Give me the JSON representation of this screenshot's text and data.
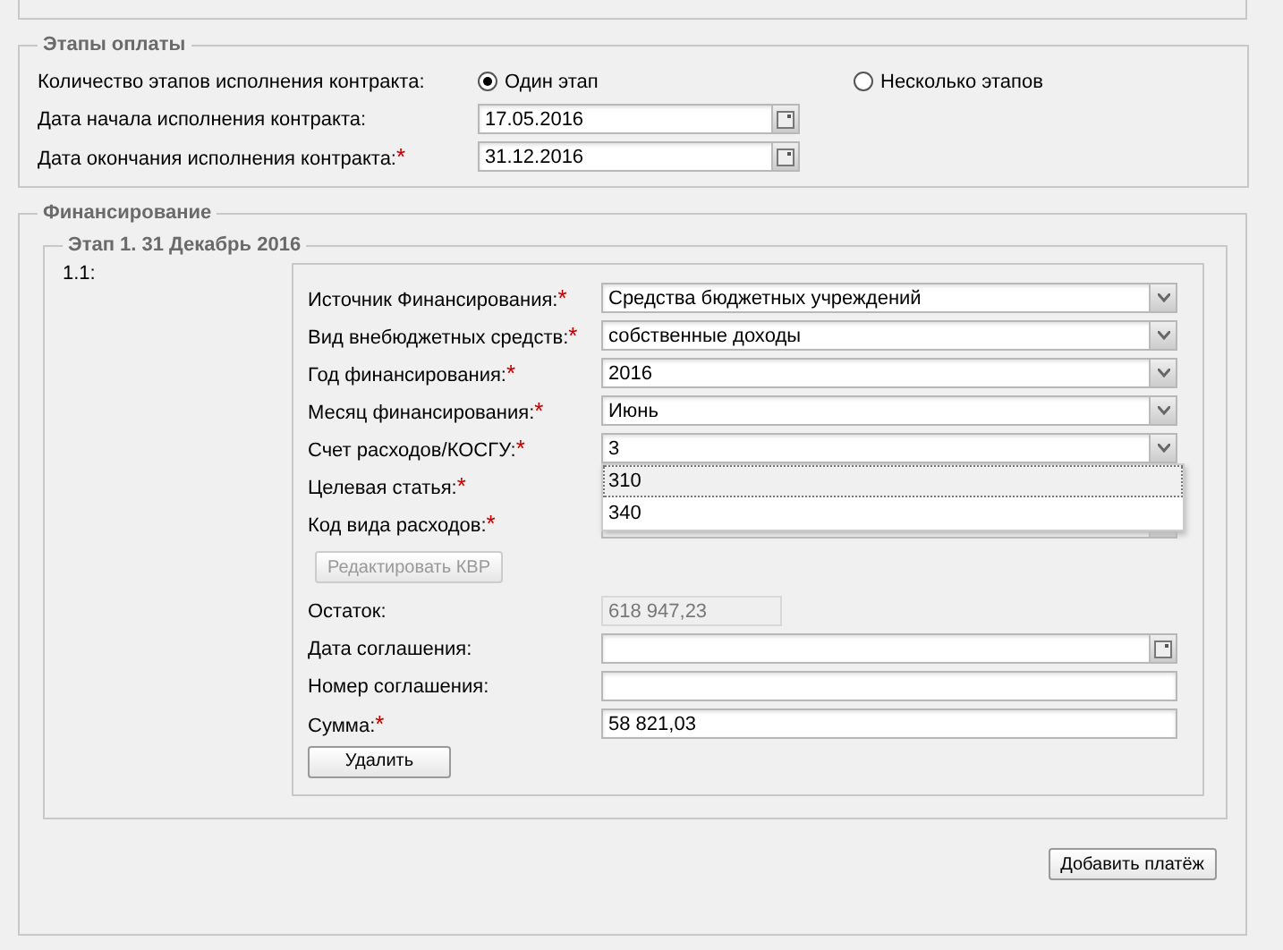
{
  "payment_stages": {
    "legend": "Этапы оплаты",
    "stage_count": {
      "label": "Количество этапов исполнения контракта:",
      "options": [
        {
          "label": "Один этап",
          "selected": true
        },
        {
          "label": "Несколько этапов",
          "selected": false
        }
      ]
    },
    "dates": [
      {
        "label": "Дата начала исполнения контракта:",
        "value": "17.05.2016"
      },
      {
        "label": "Дата окончания исполнения контракта:",
        "mark": "*",
        "value": "31.12.2016"
      }
    ]
  },
  "financing": {
    "legend": "Финансирование",
    "stage": {
      "legend": "Этап 1. 31 Декабрь 2016",
      "number": "1.1:",
      "fields": [
        {
          "kind": "select",
          "label": "Источник Финансирования:",
          "mark": "*",
          "value": "Средства бюджетных учреждений"
        },
        {
          "kind": "select",
          "label": "Вид внебюджетных средств:",
          "mark": "*",
          "value": "собственные доходы"
        },
        {
          "kind": "select",
          "label": "Год финансирования:",
          "mark": "*",
          "value": "2016"
        },
        {
          "kind": "select",
          "label": "Месяц финансирования:",
          "mark": "*",
          "value": "Июнь"
        },
        {
          "kind": "select",
          "label": "Счет расходов/КОСГУ:",
          "mark": "*",
          "value": "3",
          "options": [
            {
              "label": "310",
              "selected": true
            },
            {
              "label": "340",
              "selected": false
            }
          ]
        },
        {
          "kind": "select",
          "label": "Целевая статья:",
          "mark": "*"
        },
        {
          "kind": "select",
          "label": "Код вида расходов:",
          "mark": "*"
        },
        {
          "kind": "button",
          "label": "Редактировать КВР",
          "disabled": true
        },
        {
          "kind": "readonly",
          "label": "Остаток:",
          "value": "618 947,23"
        },
        {
          "kind": "date",
          "label": "Дата соглашения:"
        },
        {
          "kind": "text",
          "label": "Номер соглашения:"
        },
        {
          "kind": "text",
          "label": "Сумма:",
          "mark": "*",
          "value": "58 821,03"
        }
      ],
      "delete_button": "Удалить"
    },
    "add_button": "Добавить платёж"
  }
}
